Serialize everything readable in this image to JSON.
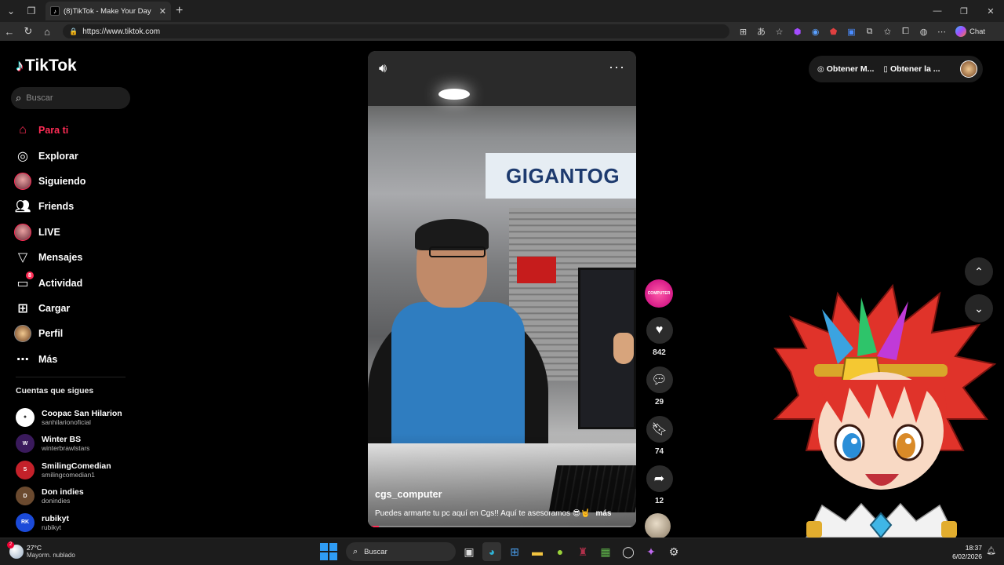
{
  "browser": {
    "tab_title": "(8)TikTok - Make Your Day",
    "url": "https://www.tiktok.com",
    "chat_label": "Chat"
  },
  "sidebar": {
    "logo_text": "TikTok",
    "search_placeholder": "Buscar",
    "nav": [
      {
        "label": "Para ti",
        "icon": "home-icon",
        "active": true
      },
      {
        "label": "Explorar",
        "icon": "compass-icon"
      },
      {
        "label": "Siguiendo",
        "icon": "avatar-icon"
      },
      {
        "label": "Friends",
        "icon": "friends-icon"
      },
      {
        "label": "LIVE",
        "icon": "avatar-icon"
      },
      {
        "label": "Mensajes",
        "icon": "send-icon"
      },
      {
        "label": "Actividad",
        "icon": "inbox-icon",
        "badge": "8"
      },
      {
        "label": "Cargar",
        "icon": "plus-square-icon"
      },
      {
        "label": "Perfil",
        "icon": "profile-icon"
      },
      {
        "label": "Más",
        "icon": "more-icon"
      }
    ],
    "following_title": "Cuentas que sigues",
    "following": [
      {
        "name": "Coopac San Hilarion",
        "user": "sanhilarionoficial"
      },
      {
        "name": "Winter BS",
        "user": "winterbrawlstars"
      },
      {
        "name": "SmilingComedian",
        "user": "smilingcomedian1"
      },
      {
        "name": "Don indies",
        "user": "donindies"
      },
      {
        "name": "rubikyt",
        "user": "rubikyt"
      }
    ]
  },
  "video": {
    "author": "cgs_computer",
    "caption": "Puedes armarte tu pc aquí en Cgs!! Aquí te asesoramos 😎🤘",
    "more_label": "más",
    "sign_text": "GIGANTOG",
    "creator_label": "COMPUTER",
    "progress": 0.04
  },
  "actions": {
    "likes": "842",
    "comments": "29",
    "saves": "74",
    "shares": "12"
  },
  "topright": {
    "get_coins": "Obtener M...",
    "get_app": "Obtener la ..."
  },
  "taskbar": {
    "temperature": "27°C",
    "condition": "Mayorm. nublado",
    "weather_badge": "2",
    "search_label": "Buscar",
    "time": "18:37",
    "date": "6/02/2026"
  },
  "colors": {
    "accent": "#fe2c55",
    "background": "#000000"
  }
}
